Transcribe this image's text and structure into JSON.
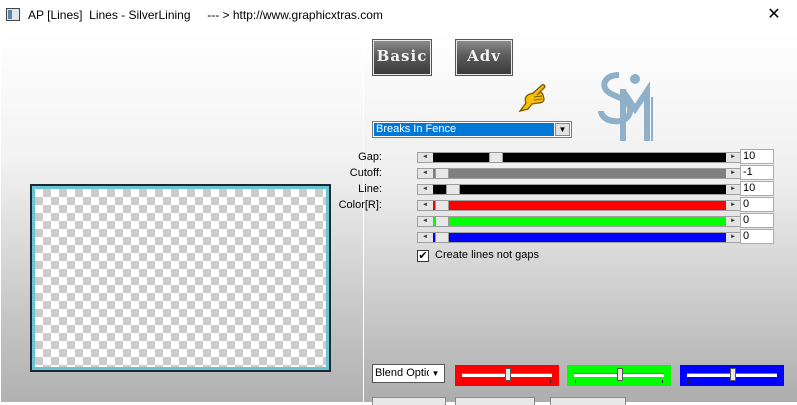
{
  "window": {
    "title": "AP [Lines]  Lines - SilverLining     --- > http://www.graphicxtras.com",
    "close_glyph": "✕"
  },
  "toolbar": {
    "basic_label": "Basic",
    "adv_label": "Adv"
  },
  "effect": {
    "selected": "Breaks In Fence",
    "arrow_glyph": "▼"
  },
  "labels": {
    "gap": "Gap:",
    "cutoff": "Cutoff:",
    "line": "Line:",
    "color": "Color[R]:"
  },
  "values": {
    "gap": "10",
    "cutoff": "-1",
    "line": "10",
    "color_r": "0",
    "color_g": "0",
    "color_b": "0"
  },
  "slider_colors": {
    "gap": "#000000",
    "cutoff": "#7f7f7f",
    "line": "#000000",
    "red": "#ff0000",
    "green": "#00ff00",
    "blue": "#0000ff"
  },
  "checkbox": {
    "label": "Create lines not gaps",
    "checked": true,
    "glyph": "✔"
  },
  "blend": {
    "label": "Blend Optio",
    "arrow_glyph": "▼"
  },
  "mini_sliders": {
    "red": "#ff0000",
    "green": "#00ff00",
    "blue": "#0000ff"
  },
  "icons": {
    "app": "app-icon",
    "pointer": "pointing-hand-icon",
    "logo": "sm-logo"
  }
}
